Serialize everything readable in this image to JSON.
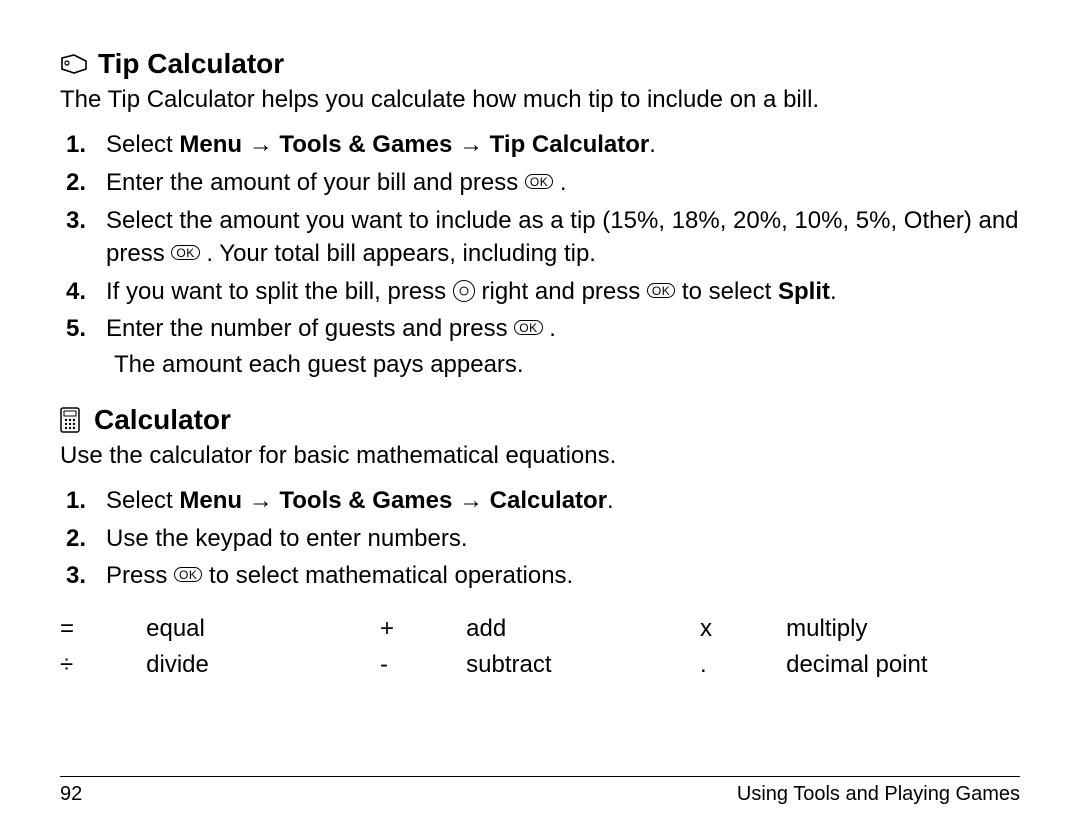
{
  "sections": [
    {
      "icon": "tag-icon",
      "title": "Tip Calculator",
      "intro": "The Tip Calculator helps you calculate how much tip to include on a bill.",
      "steps": [
        {
          "parts": [
            {
              "t": "Select "
            },
            {
              "t": "Menu",
              "bold": true
            },
            {
              "t": " → ",
              "bold": true,
              "arrow": true
            },
            {
              "t": "Tools & Games",
              "bold": true
            },
            {
              "t": " → ",
              "bold": true,
              "arrow": true
            },
            {
              "t": "Tip Calculator",
              "bold": true
            },
            {
              "t": "."
            }
          ]
        },
        {
          "parts": [
            {
              "t": "Enter the amount of your bill and press "
            },
            {
              "ok": true
            },
            {
              "t": " ."
            }
          ]
        },
        {
          "parts": [
            {
              "t": "Select the amount you want to include as a tip (15%, 18%, 20%, 10%, 5%, Other) and press "
            },
            {
              "ok": true
            },
            {
              "t": " . Your total bill appears, including tip."
            }
          ]
        },
        {
          "parts": [
            {
              "t": "If you want to split the bill, press "
            },
            {
              "nav": true
            },
            {
              "t": " right and press "
            },
            {
              "ok": true
            },
            {
              "t": " to select "
            },
            {
              "t": "Split",
              "bold": true
            },
            {
              "t": "."
            }
          ]
        },
        {
          "parts": [
            {
              "t": "Enter the number of guests and press "
            },
            {
              "ok": true
            },
            {
              "t": " ."
            }
          ],
          "sub": "The amount each guest pays appears."
        }
      ]
    },
    {
      "icon": "calc-icon",
      "title": "Calculator",
      "intro": "Use the calculator for basic mathematical equations.",
      "steps": [
        {
          "parts": [
            {
              "t": "Select "
            },
            {
              "t": "Menu",
              "bold": true
            },
            {
              "t": " → ",
              "bold": true,
              "arrow": true
            },
            {
              "t": "Tools & Games",
              "bold": true
            },
            {
              "t": " → ",
              "bold": true,
              "arrow": true
            },
            {
              "t": "Calculator",
              "bold": true
            },
            {
              "t": "."
            }
          ]
        },
        {
          "parts": [
            {
              "t": "Use the keypad to enter numbers."
            }
          ]
        },
        {
          "parts": [
            {
              "t": "Press "
            },
            {
              "ok": true
            },
            {
              "t": " to select mathematical operations."
            }
          ]
        }
      ],
      "ops": [
        [
          {
            "sym": "=",
            "label": "equal"
          },
          {
            "sym": "+",
            "label": "add"
          },
          {
            "sym": "x",
            "label": "multiply"
          }
        ],
        [
          {
            "sym": "÷",
            "label": "divide"
          },
          {
            "sym": "-",
            "label": "subtract"
          },
          {
            "sym": ".",
            "label": "decimal point"
          }
        ]
      ]
    }
  ],
  "footer": {
    "page": "92",
    "chapter": "Using Tools and Playing Games"
  },
  "ok_label": "OK"
}
